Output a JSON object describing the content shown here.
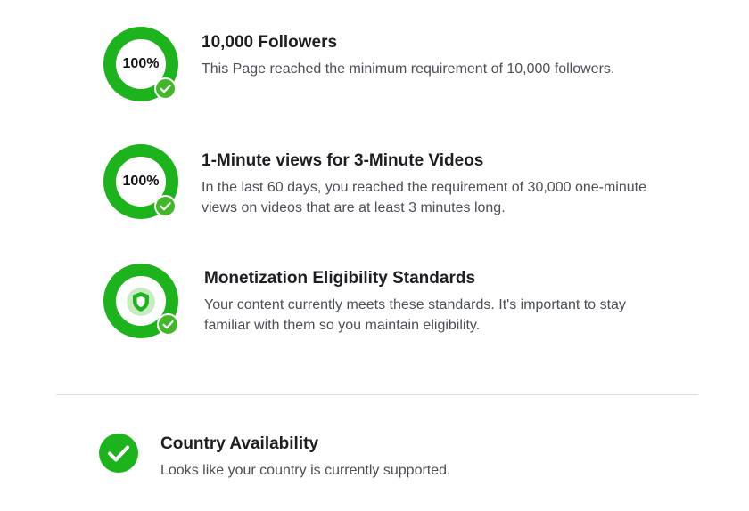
{
  "requirements": [
    {
      "title": "10,000 Followers",
      "description": "This Page reached the minimum requirement of 10,000 followers.",
      "progress_label": "100%",
      "progress": 1.0,
      "status_icon": "check-circle-icon"
    },
    {
      "title": "1-Minute views for 3-Minute Videos",
      "description": "In the last 60 days, you reached the requirement of 30,000 one-minute views on videos that are at least 3 minutes long.",
      "progress_label": "100%",
      "progress": 1.0,
      "status_icon": "check-circle-icon"
    },
    {
      "title": "Monetization Eligibility Standards",
      "description": "Your content currently meets these standards. It's important to stay familiar with them so you maintain eligibility.",
      "center_icon": "shield-icon",
      "status_icon": "check-circle-icon"
    }
  ],
  "country": {
    "title": "Country Availability",
    "description": "Looks like your country is currently supported.",
    "status_icon": "check-circle-icon"
  },
  "colors": {
    "accent_green": "#1db31d",
    "badge_green": "#42b72a",
    "title_text": "#1c1e21",
    "body_text": "#4b4f56",
    "divider": "#dddfe2"
  }
}
